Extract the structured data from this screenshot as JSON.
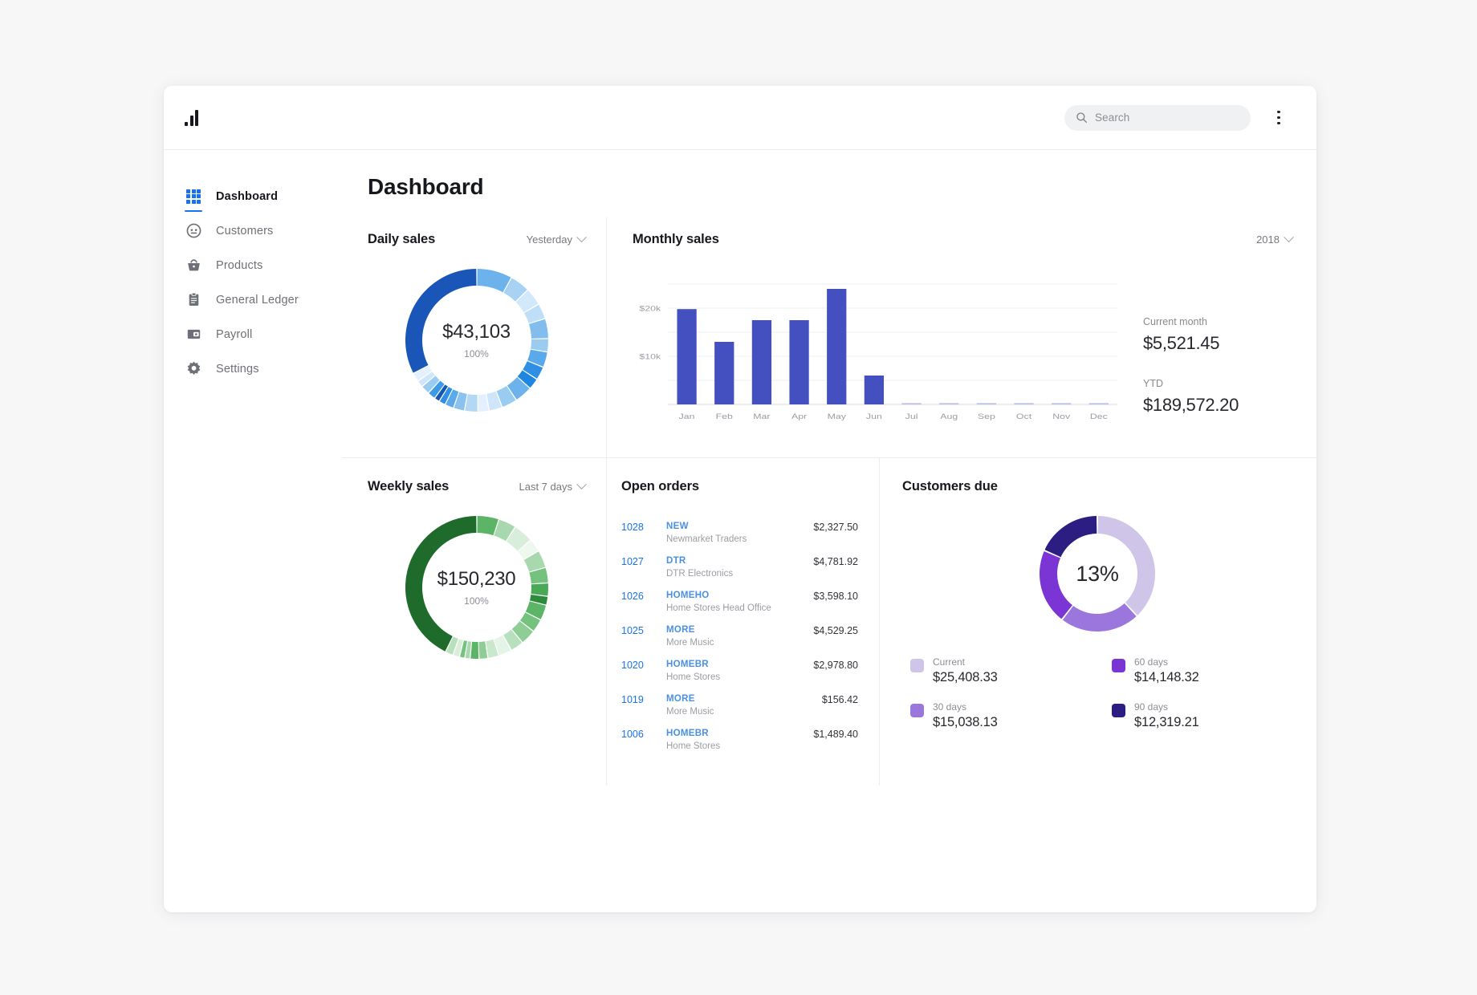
{
  "topbar": {
    "logo_icon": "bar-chart-logo",
    "search_placeholder": "Search",
    "search_value": "",
    "search_icon": "search-icon",
    "menu_icon": "kebab-menu-icon"
  },
  "sidebar": {
    "items": [
      {
        "label": "Dashboard",
        "icon": "grid-icon",
        "active": true
      },
      {
        "label": "Customers",
        "icon": "person-icon",
        "active": false
      },
      {
        "label": "Products",
        "icon": "basket-icon",
        "active": false
      },
      {
        "label": "General Ledger",
        "icon": "clipboard-icon",
        "active": false
      },
      {
        "label": "Payroll",
        "icon": "wallet-icon",
        "active": false
      },
      {
        "label": "Settings",
        "icon": "gear-icon",
        "active": false
      }
    ]
  },
  "page": {
    "title": "Dashboard"
  },
  "daily_sales": {
    "title": "Daily sales",
    "range_label": "Yesterday",
    "value": "$43,103",
    "percent": "100%"
  },
  "monthly_sales": {
    "title": "Monthly sales",
    "year_label": "2018",
    "current_month_label": "Current month",
    "current_month_value": "$5,521.45",
    "ytd_label": "YTD",
    "ytd_value": "$189,572.20"
  },
  "weekly_sales": {
    "title": "Weekly sales",
    "range_label": "Last 7 days",
    "value": "$150,230",
    "percent": "100%"
  },
  "open_orders": {
    "title": "Open orders",
    "rows": [
      {
        "id": "1028",
        "code": "NEW",
        "name": "Newmarket Traders",
        "amount": "$2,327.50"
      },
      {
        "id": "1027",
        "code": "DTR",
        "name": "DTR Electronics",
        "amount": "$4,781.92"
      },
      {
        "id": "1026",
        "code": "HOMEHO",
        "name": "Home Stores Head Office",
        "amount": "$3,598.10"
      },
      {
        "id": "1025",
        "code": "MORE",
        "name": "More Music",
        "amount": "$4,529.25"
      },
      {
        "id": "1020",
        "code": "HOMEBR",
        "name": "Home Stores",
        "amount": "$2,978.80"
      },
      {
        "id": "1019",
        "code": "MORE",
        "name": "More Music",
        "amount": "$156.42"
      },
      {
        "id": "1006",
        "code": "HOMEBR",
        "name": "Home Stores",
        "amount": "$1,489.40"
      }
    ]
  },
  "customers_due": {
    "title": "Customers due",
    "center_percent": "13%",
    "legend": [
      {
        "label": "Current",
        "value": "$25,408.33",
        "color": "#cfc5e8"
      },
      {
        "label": "60 days",
        "value": "$14,148.32",
        "color": "#7a35d4"
      },
      {
        "label": "30 days",
        "value": "$15,038.13",
        "color": "#9b77dd"
      },
      {
        "label": "90 days",
        "value": "$12,319.21",
        "color": "#2b1d82"
      }
    ]
  },
  "chart_data": [
    {
      "type": "bar",
      "title": "Monthly sales",
      "categories": [
        "Jan",
        "Feb",
        "Mar",
        "Apr",
        "May",
        "Jun",
        "Jul",
        "Aug",
        "Sep",
        "Oct",
        "Nov",
        "Dec"
      ],
      "values": [
        19800,
        13000,
        17500,
        17500,
        24000,
        6000,
        60,
        60,
        60,
        60,
        60,
        60
      ],
      "ylabel": "",
      "xlabel": "",
      "ytick_labels": [
        "$10k",
        "$20k"
      ],
      "ytick_values": [
        10000,
        20000
      ],
      "ylim": [
        0,
        26000
      ],
      "grid": true,
      "legend": "none",
      "bar_color": "#4550c0"
    },
    {
      "type": "pie",
      "title": "Daily sales",
      "center_label": "$43,103",
      "center_sublabel": "100%",
      "donut": true,
      "segments": [
        {
          "value": 8.0,
          "color": "#6cb2ec"
        },
        {
          "value": 4.5,
          "color": "#a8d2f4"
        },
        {
          "value": 4.0,
          "color": "#d3e8fb"
        },
        {
          "value": 3.5,
          "color": "#bfdff9"
        },
        {
          "value": 4.5,
          "color": "#82bdee"
        },
        {
          "value": 3.0,
          "color": "#9acbf1"
        },
        {
          "value": 3.5,
          "color": "#5aa9ea"
        },
        {
          "value": 3.0,
          "color": "#2f8fe4"
        },
        {
          "value": 2.5,
          "color": "#1e86e0"
        },
        {
          "value": 4.0,
          "color": "#6cb2ec"
        },
        {
          "value": 3.5,
          "color": "#9acbf1"
        },
        {
          "value": 3.0,
          "color": "#cfe6fa"
        },
        {
          "value": 2.5,
          "color": "#e4f0fd"
        },
        {
          "value": 3.0,
          "color": "#b3d8f6"
        },
        {
          "value": 2.5,
          "color": "#89c1ef"
        },
        {
          "value": 2.0,
          "color": "#5aa9ea"
        },
        {
          "value": 1.5,
          "color": "#2f8fe4"
        },
        {
          "value": 1.2,
          "color": "#1457b5"
        },
        {
          "value": 1.8,
          "color": "#3f9ae6"
        },
        {
          "value": 2.0,
          "color": "#9acbf1"
        },
        {
          "value": 1.5,
          "color": "#cfe6fa"
        },
        {
          "value": 2.0,
          "color": "#e4f0fd"
        },
        {
          "value": 32.5,
          "color": "#1a56b8"
        }
      ]
    },
    {
      "type": "pie",
      "title": "Weekly sales",
      "center_label": "$150,230",
      "center_sublabel": "100%",
      "donut": true,
      "segments": [
        {
          "value": 5.0,
          "color": "#5cb567"
        },
        {
          "value": 4.0,
          "color": "#a8d8ad"
        },
        {
          "value": 4.5,
          "color": "#d8eeda"
        },
        {
          "value": 3.0,
          "color": "#eef8ef"
        },
        {
          "value": 4.0,
          "color": "#a8d8ad"
        },
        {
          "value": 3.5,
          "color": "#74c27d"
        },
        {
          "value": 3.0,
          "color": "#4aa957"
        },
        {
          "value": 2.0,
          "color": "#2e8b3c"
        },
        {
          "value": 3.5,
          "color": "#5cb567"
        },
        {
          "value": 3.0,
          "color": "#74c27d"
        },
        {
          "value": 3.5,
          "color": "#8ecd95"
        },
        {
          "value": 3.0,
          "color": "#b9e0bd"
        },
        {
          "value": 3.0,
          "color": "#e4f4e6"
        },
        {
          "value": 2.5,
          "color": "#c9e8cc"
        },
        {
          "value": 2.0,
          "color": "#8ecd95"
        },
        {
          "value": 2.0,
          "color": "#5cb567"
        },
        {
          "value": 1.2,
          "color": "#a8d8ad"
        },
        {
          "value": 1.2,
          "color": "#74c27d"
        },
        {
          "value": 1.5,
          "color": "#d8eeda"
        },
        {
          "value": 1.8,
          "color": "#b9e0bd"
        },
        {
          "value": 42.8,
          "color": "#1f6b2c"
        }
      ]
    },
    {
      "type": "pie",
      "title": "Customers due",
      "center_label": "13%",
      "donut": true,
      "segments": [
        {
          "value": 25408.33,
          "label": "Current",
          "color": "#cfc5e8"
        },
        {
          "value": 15038.13,
          "label": "30 days",
          "color": "#9b77dd"
        },
        {
          "value": 14148.32,
          "label": "60 days",
          "color": "#7a35d4"
        },
        {
          "value": 12319.21,
          "label": "90 days",
          "color": "#2b1d82"
        }
      ]
    }
  ]
}
